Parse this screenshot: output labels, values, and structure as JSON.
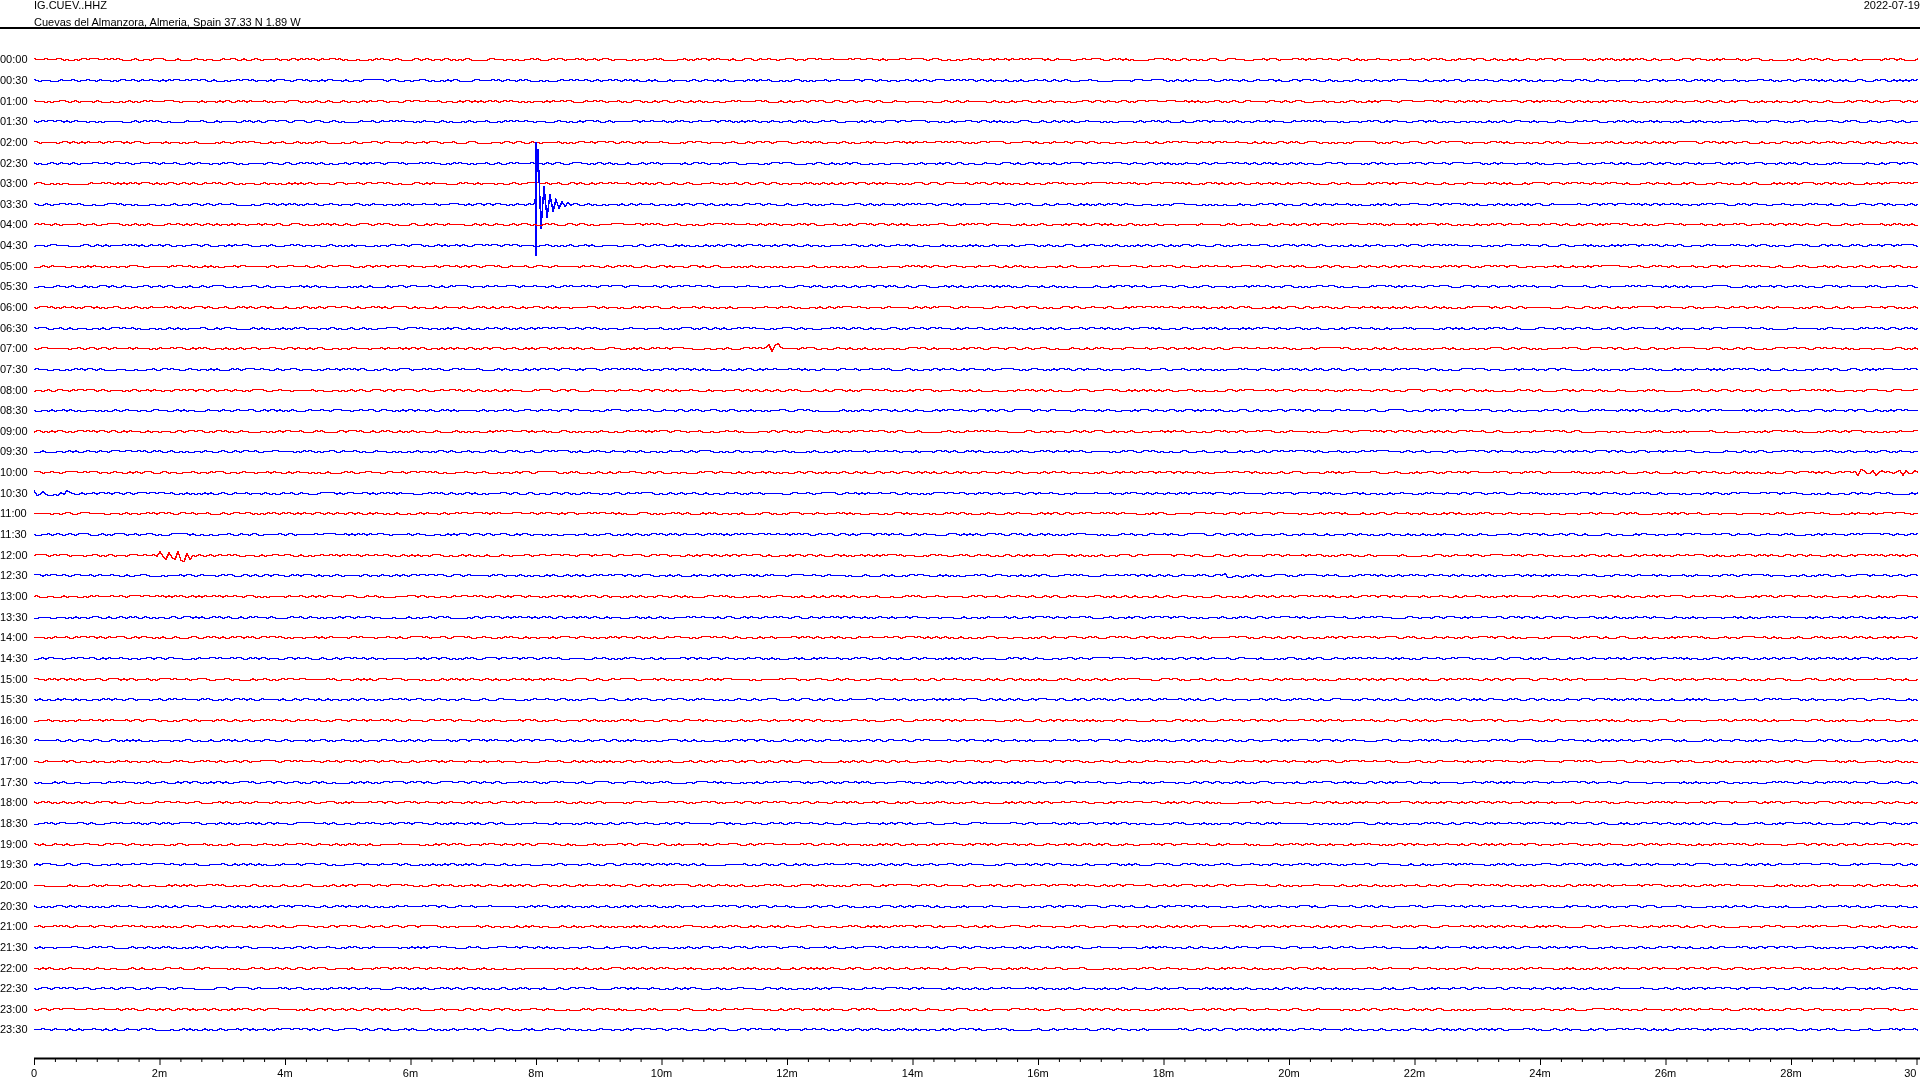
{
  "header": {
    "station": "IG.CUEV..HHZ",
    "location": "Cuevas del Almanzora, Almeria, Spain  37.33 N 1.89 W",
    "date": "2022-07-19"
  },
  "traces": [
    {
      "time": "00:00",
      "color": "#ff0000"
    },
    {
      "time": "00:30",
      "color": "#0000ff"
    },
    {
      "time": "01:00",
      "color": "#ff0000"
    },
    {
      "time": "01:30",
      "color": "#0000ff"
    },
    {
      "time": "02:00",
      "color": "#ff0000"
    },
    {
      "time": "02:30",
      "color": "#0000ff"
    },
    {
      "time": "03:00",
      "color": "#ff0000"
    },
    {
      "time": "03:30",
      "color": "#0000ff"
    },
    {
      "time": "04:00",
      "color": "#ff0000"
    },
    {
      "time": "04:30",
      "color": "#0000ff"
    },
    {
      "time": "05:00",
      "color": "#ff0000"
    },
    {
      "time": "05:30",
      "color": "#0000ff"
    },
    {
      "time": "06:00",
      "color": "#ff0000"
    },
    {
      "time": "06:30",
      "color": "#0000ff"
    },
    {
      "time": "07:00",
      "color": "#ff0000"
    },
    {
      "time": "07:30",
      "color": "#0000ff"
    },
    {
      "time": "08:00",
      "color": "#ff0000"
    },
    {
      "time": "08:30",
      "color": "#0000ff"
    },
    {
      "time": "09:00",
      "color": "#ff0000"
    },
    {
      "time": "09:30",
      "color": "#0000ff"
    },
    {
      "time": "10:00",
      "color": "#ff0000"
    },
    {
      "time": "10:30",
      "color": "#0000ff"
    },
    {
      "time": "11:00",
      "color": "#ff0000"
    },
    {
      "time": "11:30",
      "color": "#0000ff"
    },
    {
      "time": "12:00",
      "color": "#ff0000"
    },
    {
      "time": "12:30",
      "color": "#0000ff"
    },
    {
      "time": "13:00",
      "color": "#ff0000"
    },
    {
      "time": "13:30",
      "color": "#0000ff"
    },
    {
      "time": "14:00",
      "color": "#ff0000"
    },
    {
      "time": "14:30",
      "color": "#0000ff"
    },
    {
      "time": "15:00",
      "color": "#ff0000"
    },
    {
      "time": "15:30",
      "color": "#0000ff"
    },
    {
      "time": "16:00",
      "color": "#ff0000"
    },
    {
      "time": "16:30",
      "color": "#0000ff"
    },
    {
      "time": "17:00",
      "color": "#ff0000"
    },
    {
      "time": "17:30",
      "color": "#0000ff"
    },
    {
      "time": "18:00",
      "color": "#ff0000"
    },
    {
      "time": "18:30",
      "color": "#0000ff"
    },
    {
      "time": "19:00",
      "color": "#ff0000"
    },
    {
      "time": "19:30",
      "color": "#0000ff"
    },
    {
      "time": "20:00",
      "color": "#ff0000"
    },
    {
      "time": "20:30",
      "color": "#0000ff"
    },
    {
      "time": "21:00",
      "color": "#ff0000"
    },
    {
      "time": "21:30",
      "color": "#0000ff"
    },
    {
      "time": "22:00",
      "color": "#ff0000"
    },
    {
      "time": "22:30",
      "color": "#0000ff"
    },
    {
      "time": "23:00",
      "color": "#ff0000"
    },
    {
      "time": "23:30",
      "color": "#0000ff"
    }
  ],
  "time_axis": {
    "labels": [
      "0",
      "2m",
      "4m",
      "6m",
      "8m",
      "10m",
      "12m",
      "14m",
      "16m",
      "18m",
      "20m",
      "22m",
      "24m",
      "26m",
      "28m",
      "30"
    ]
  }
}
